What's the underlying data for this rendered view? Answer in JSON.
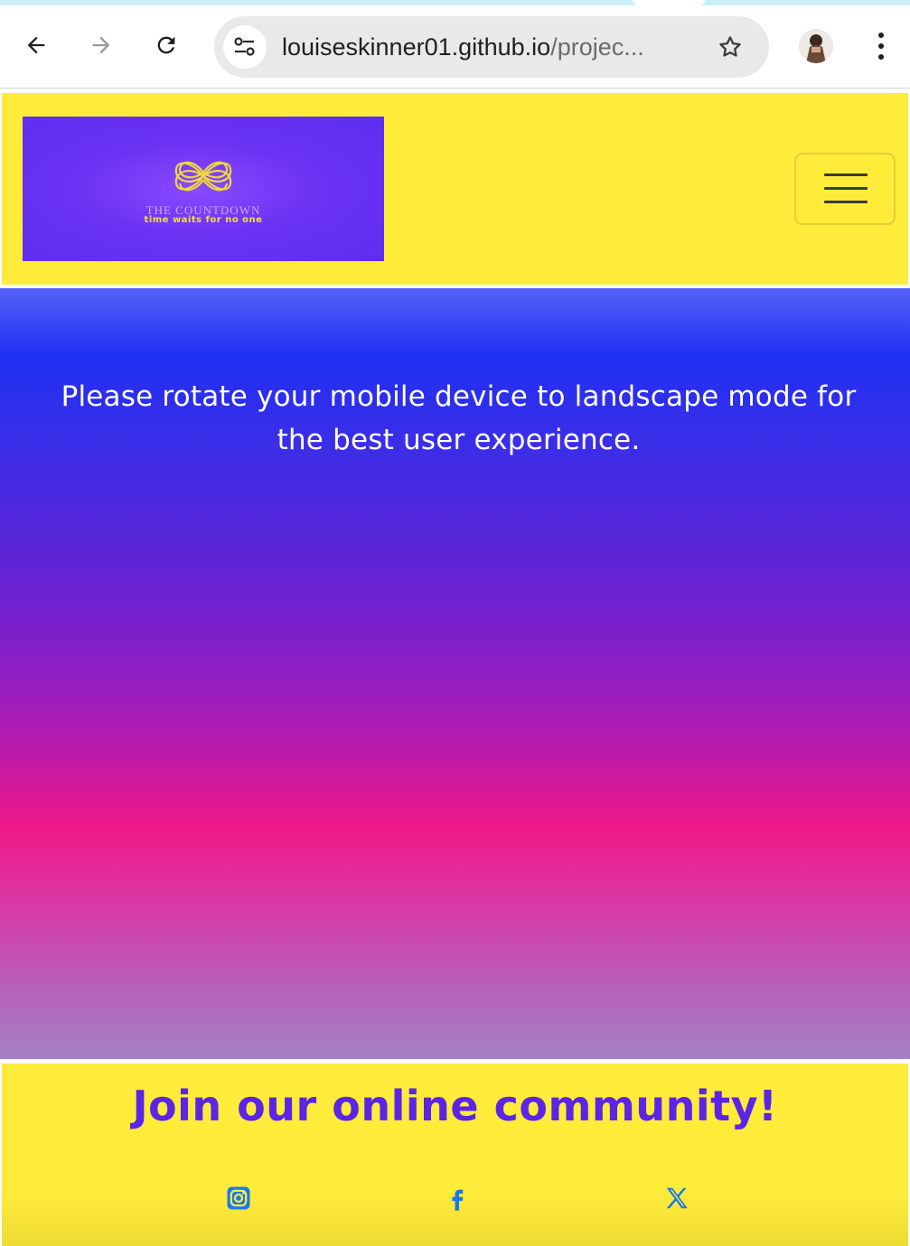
{
  "browser": {
    "url_host": "louiseskinner01.github.io",
    "url_rest": "/projec...",
    "icons": [
      "back-arrow-icon",
      "forward-arrow-icon",
      "reload-icon",
      "site-settings-icon",
      "bookmark-star-icon",
      "profile-avatar",
      "more-menu-icon"
    ]
  },
  "header": {
    "logo_title": "THE COUNTDOWN",
    "logo_tagline": "time waits for no one",
    "menu_icon": "hamburger-icon"
  },
  "hero": {
    "message": "Please rotate your mobile device to landscape mode for the best user experience."
  },
  "footer": {
    "title": "Join our online community!",
    "social": [
      "instagram-icon",
      "facebook-icon",
      "x-icon"
    ]
  },
  "colors": {
    "header_bg": "#ffec3a",
    "accent_purple": "#5b24e6",
    "social_blue": "#1877f2"
  }
}
